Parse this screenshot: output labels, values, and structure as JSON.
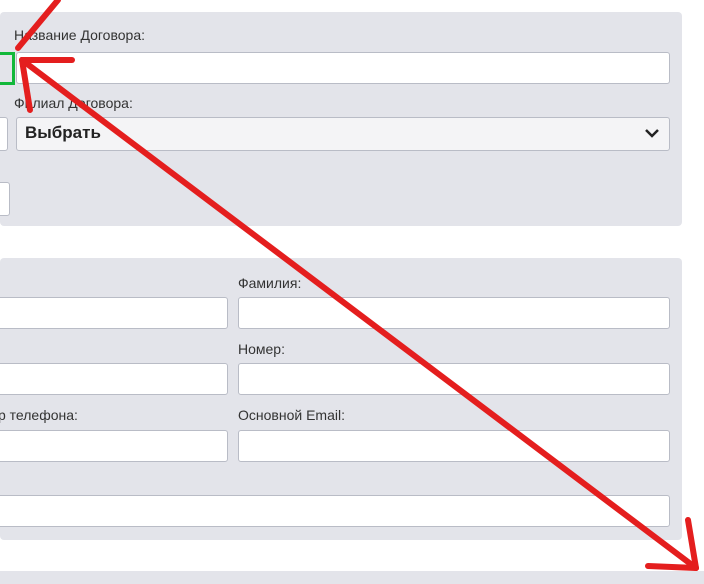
{
  "contract": {
    "name_label": "Название Договора:",
    "name_value": "",
    "branch_label": "Филиал Договора:",
    "branch_selected": "Выбрать"
  },
  "contact": {
    "last_name_label": "Фамилия:",
    "last_name_value": "",
    "number_label": "Номер:",
    "number_value": "",
    "phone_label_partial": "р телефона:",
    "phone_value": "",
    "email_label": "Основной Email:",
    "email_value": ""
  },
  "icons": [
    "chevron-down-icon",
    "annotation-arrow-icon"
  ],
  "colors": {
    "panel": "#e3e4ea",
    "highlight": "#12b83a",
    "annotation": "#e41e1e"
  }
}
